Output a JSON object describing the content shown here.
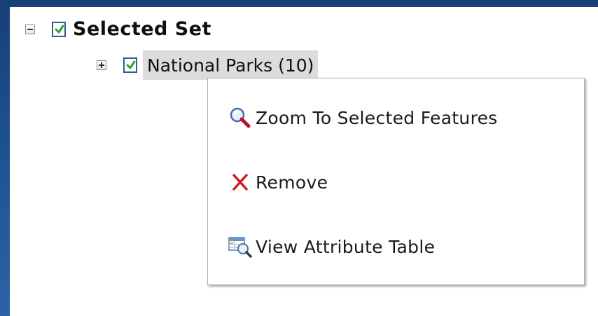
{
  "tree": {
    "root": {
      "label": "Selected Set",
      "expander": "minus-icon",
      "checked": true
    },
    "child": {
      "label": "National Parks (10)",
      "expander": "plus-icon",
      "checked": true
    }
  },
  "context_menu": {
    "items": [
      {
        "label": "Zoom To Selected Features",
        "icon": "magnifier-icon"
      },
      {
        "label": "Remove",
        "icon": "red-x-icon"
      },
      {
        "label": "View Attribute Table",
        "icon": "attribute-table-icon"
      }
    ]
  },
  "colors": {
    "background": "#1d4f8e",
    "checkmark": "#2aa52a",
    "remove_x": "#cc1f1f",
    "selection_highlight": "#dcdcdc"
  }
}
